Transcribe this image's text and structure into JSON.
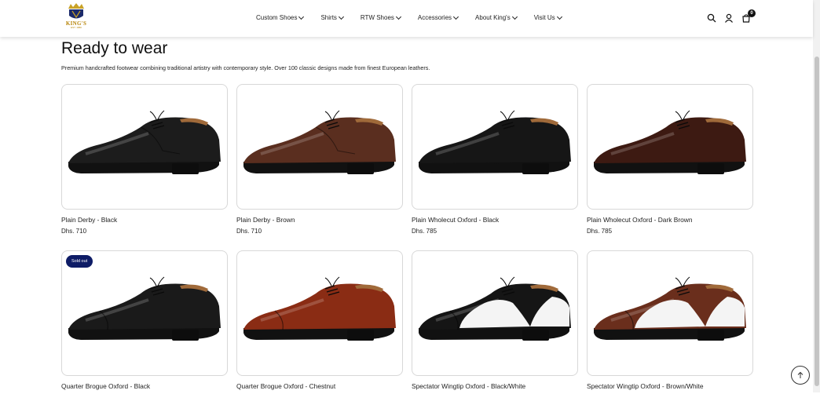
{
  "brand": {
    "logo_text": "KING'S",
    "logo_sub": "EST. 1880"
  },
  "nav": {
    "items": [
      {
        "label": "Custom Shoes"
      },
      {
        "label": "Shirts"
      },
      {
        "label": "RTW Shoes"
      },
      {
        "label": "Accessories"
      },
      {
        "label": "About King's"
      },
      {
        "label": "Visit Us"
      }
    ]
  },
  "header_icons": {
    "search": "search-icon",
    "account": "user-icon",
    "cart": "bag-icon",
    "cart_count": "0"
  },
  "page": {
    "title": "Ready to wear",
    "description": "Premium handcrafted footwear combining traditional artistry with contemporary style. Over 100 classic designs made from finest European leathers."
  },
  "products": [
    {
      "title": "Plain Derby - Black",
      "price": "Dhs. 710",
      "color": "#1c1c1c",
      "style": "derby"
    },
    {
      "title": "Plain Derby - Brown",
      "price": "Dhs. 710",
      "color": "#5a2e1f",
      "style": "derby"
    },
    {
      "title": "Plain Wholecut Oxford - Black",
      "price": "Dhs. 785",
      "color": "#161616",
      "style": "wholecut"
    },
    {
      "title": "Plain Wholecut Oxford - Dark Brown",
      "price": "Dhs. 785",
      "color": "#3d1a12",
      "style": "wholecut"
    },
    {
      "title": "Quarter Brogue Oxford - Black",
      "price": "",
      "color": "#1a1a1a",
      "style": "captoe",
      "badge": "Sold out"
    },
    {
      "title": "Quarter Brogue Oxford - Chestnut",
      "price": "",
      "color": "#8a2c14",
      "style": "captoe"
    },
    {
      "title": "Spectator Wingtip Oxford - Black/White",
      "price": "",
      "color": "#151515",
      "style": "spectator"
    },
    {
      "title": "Spectator Wingtip Oxford - Brown/White",
      "price": "",
      "color": "#6a2e1c",
      "style": "spectator"
    }
  ],
  "back_to_top_icon": "arrow-up-icon"
}
